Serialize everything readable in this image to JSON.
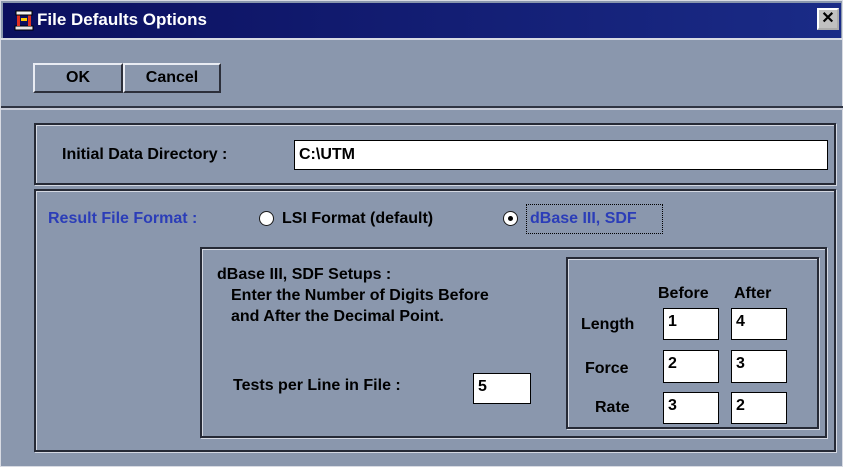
{
  "window": {
    "title": "File Defaults Options",
    "close_glyph": "✕"
  },
  "toolbar": {
    "ok_label": "OK",
    "cancel_label": "Cancel"
  },
  "directory": {
    "label": "Initial Data Directory :",
    "value": "C:\\UTM"
  },
  "format": {
    "label": "Result File Format :",
    "options": [
      {
        "label": "LSI Format (default)",
        "selected": false
      },
      {
        "label": "dBase III, SDF",
        "selected": true
      }
    ]
  },
  "setup": {
    "title": "dBase III, SDF Setups :",
    "line1": "Enter the Number of Digits Before",
    "line2": "and After the Decimal Point.",
    "tests_label": "Tests per Line in File :",
    "tests_value": "5"
  },
  "digits": {
    "before_header": "Before",
    "after_header": "After",
    "rows": [
      {
        "label": "Length",
        "before": "1",
        "after": "4"
      },
      {
        "label": "Force",
        "before": "2",
        "after": "3"
      },
      {
        "label": "Rate",
        "before": "3",
        "after": "2"
      }
    ]
  },
  "colors": {
    "dialog_bg": "#8a97ad",
    "title_bar": "#0b0f5e",
    "accent_label": "#2b3db8"
  }
}
